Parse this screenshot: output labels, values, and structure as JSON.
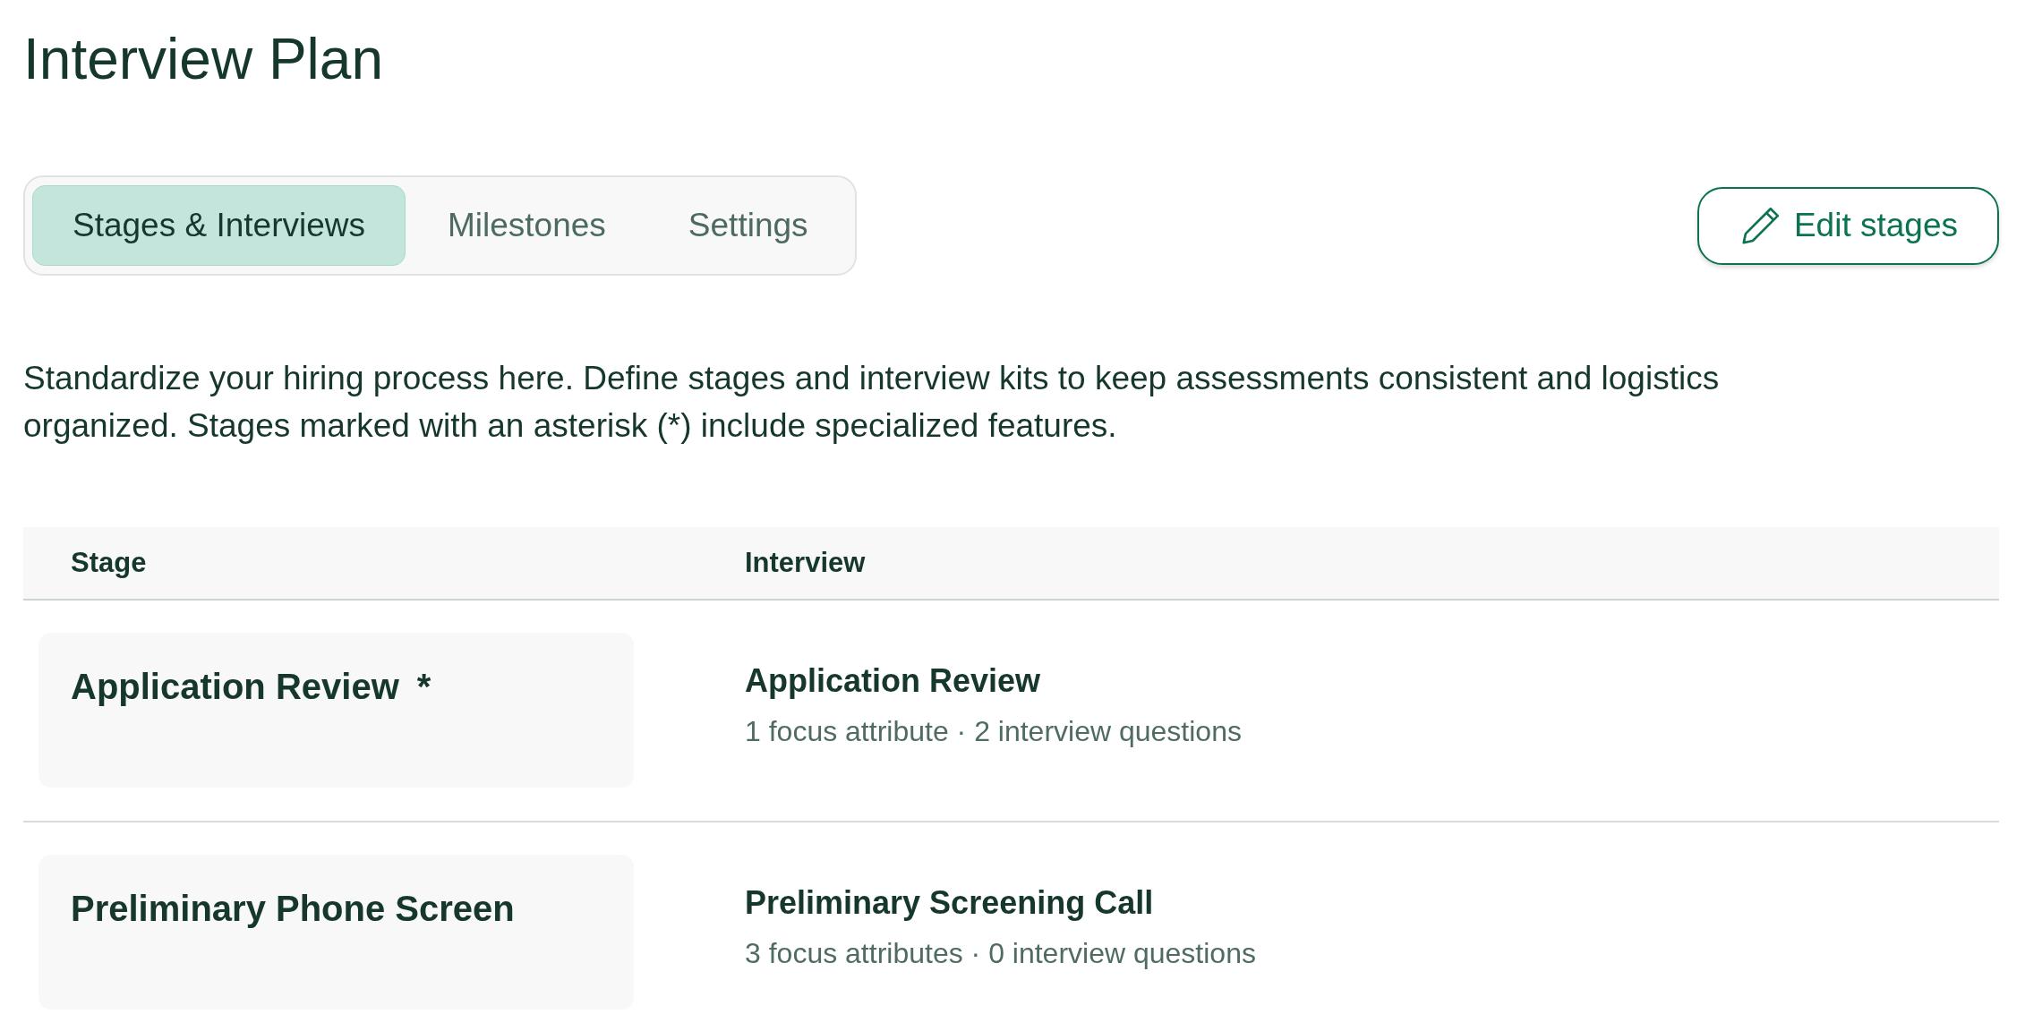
{
  "page": {
    "title": "Interview Plan"
  },
  "tabs": [
    {
      "label": "Stages & Interviews",
      "selected": true
    },
    {
      "label": "Milestones",
      "selected": false
    },
    {
      "label": "Settings",
      "selected": false
    }
  ],
  "edit_button": {
    "label": "Edit stages"
  },
  "description": "Standardize your hiring process here. Define stages and interview kits to keep assessments consistent and logistics organized. Stages marked with an asterisk (*) include specialized features.",
  "table": {
    "columns": [
      "Stage",
      "Interview"
    ],
    "rows": [
      {
        "stage": "Application Review",
        "marker": "*",
        "interview": "Application Review",
        "details": "1 focus attribute · 2 interview questions"
      },
      {
        "stage": "Preliminary Phone Screen",
        "interview": "Preliminary Screening Call",
        "details": "3 focus attributes · 0 interview questions"
      }
    ]
  }
}
